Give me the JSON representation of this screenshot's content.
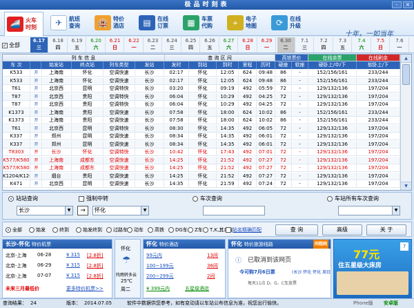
{
  "window": {
    "title": "极品时刻表",
    "minimize": "-",
    "close": "×"
  },
  "toolbar": {
    "items": [
      {
        "label": "火车时刻",
        "icon": "train-icon"
      },
      {
        "label": "航班查询",
        "icon": "plane-icon"
      },
      {
        "label": "特价酒店",
        "icon": "hotel-icon"
      },
      {
        "label": "在线订票",
        "icon": "ticket-icon"
      },
      {
        "label": "车票代购",
        "icon": "cart-icon"
      },
      {
        "label": "电子地图",
        "icon": "map-icon"
      },
      {
        "label": "在线升级",
        "icon": "upgrade-icon"
      }
    ],
    "slogan": "十年，一如当年"
  },
  "datebar": {
    "all_label": "全部",
    "dates": [
      {
        "date": "6.17",
        "week": "三"
      },
      {
        "date": "6.18",
        "week": "四"
      },
      {
        "date": "6.19",
        "week": "五"
      },
      {
        "date": "6.20",
        "week": "六"
      },
      {
        "date": "6.21",
        "week": "日"
      },
      {
        "date": "6.22",
        "week": "一"
      },
      {
        "date": "6.23",
        "week": "二"
      },
      {
        "date": "6.24",
        "week": "三"
      },
      {
        "date": "6.25",
        "week": "四"
      },
      {
        "date": "6.26",
        "week": "五"
      },
      {
        "date": "6.27",
        "week": "六"
      },
      {
        "date": "6.28",
        "week": "日"
      },
      {
        "date": "6.29",
        "week": "一"
      },
      {
        "date": "6.30",
        "week": "二"
      },
      {
        "date": "7.1",
        "week": "三"
      },
      {
        "date": "7.2",
        "week": "四"
      },
      {
        "date": "7.3",
        "week": "五"
      },
      {
        "date": "7.4",
        "week": "六"
      },
      {
        "date": "7.5",
        "week": "日"
      },
      {
        "date": "7.6",
        "week": "一"
      }
    ]
  },
  "grid": {
    "group_headers": [
      "列 车 信 息",
      "查 询 区 间",
      "高铁票价",
      "在线余票",
      "在线刷余"
    ],
    "columns": [
      "车 次",
      "",
      "始发站",
      "终点站",
      "列车类型",
      "发站",
      "发时",
      "到站",
      "到时",
      "里程",
      "历时",
      "硬座",
      "软座",
      "硬卧上/中/下",
      "软卧上/下"
    ],
    "rows": [
      [
        "K533",
        "开",
        "上海南",
        "怀化",
        "空调快速",
        "长沙",
        "02:17",
        "怀化",
        "12:05",
        "624",
        "09:48",
        "86",
        "-",
        "152/156/161",
        "233/244"
      ],
      [
        "K533",
        "开",
        "上海南",
        "怀化",
        "空调快速",
        "长沙",
        "02:17",
        "怀化",
        "12:05",
        "624",
        "09:48",
        "86",
        "-",
        "152/156/161",
        "233/244"
      ],
      [
        "T61",
        "开",
        "北京西",
        "昆明",
        "空调特快",
        "长沙",
        "03:20",
        "怀化",
        "09:19",
        "492",
        "05:59",
        "72",
        "-",
        "129/132/136",
        "197/204"
      ],
      [
        "T87",
        "开",
        "北京西",
        "贵阳",
        "空调特快",
        "长沙",
        "06:04",
        "怀化",
        "10:29",
        "492",
        "04:25",
        "72",
        "-",
        "129/132/136",
        "197/204"
      ],
      [
        "T87",
        "开",
        "北京西",
        "贵阳",
        "空调特快",
        "长沙",
        "06:04",
        "怀化",
        "10:29",
        "492",
        "04:25",
        "72",
        "-",
        "129/132/136",
        "197/204"
      ],
      [
        "K1373",
        "开",
        "上海南",
        "贵阳",
        "空调快速",
        "长沙",
        "07:58",
        "怀化",
        "18:00",
        "624",
        "10:02",
        "86",
        "-",
        "152/156/161",
        "233/244"
      ],
      [
        "K1373",
        "开",
        "上海南",
        "贵阳",
        "空调快速",
        "长沙",
        "07:58",
        "怀化",
        "18:00",
        "624",
        "10:02",
        "86",
        "-",
        "152/156/161",
        "233/244"
      ],
      [
        "T61",
        "开",
        "北京西",
        "昆明",
        "空调特快",
        "长沙",
        "08:30",
        "怀化",
        "14:35",
        "492",
        "06:05",
        "72",
        "-",
        "129/132/136",
        "197/204"
      ],
      [
        "K337",
        "开",
        "郑州",
        "昆明",
        "空调快速",
        "长沙",
        "08:34",
        "怀化",
        "14:35",
        "492",
        "06:01",
        "72",
        "-",
        "129/132/136",
        "197/204"
      ],
      [
        "K337",
        "开",
        "郑州",
        "昆明",
        "空调快速",
        "长沙",
        "08:34",
        "怀化",
        "14:35",
        "492",
        "06:01",
        "72",
        "-",
        "129/132/136",
        "197/204"
      ],
      [
        "T8303",
        "开",
        "长沙",
        "怀化",
        "空调特快",
        "长沙",
        "10:42",
        "怀化",
        "17:43",
        "492",
        "07:01",
        "72",
        "-",
        "129/132/136",
        "197/204"
      ],
      [
        "K577/K580",
        "开",
        "上海南",
        "成都东",
        "空调快速",
        "长沙",
        "14:25",
        "怀化",
        "21:52",
        "492",
        "07:27",
        "72",
        "-",
        "129/132/136",
        "197/204"
      ],
      [
        "K577/K580",
        "开",
        "上海南",
        "成都东",
        "空调快速",
        "长沙",
        "14:25",
        "怀化",
        "21:52",
        "492",
        "07:27",
        "72",
        "-",
        "129/132/136",
        "197/204"
      ],
      [
        "K1204/K1205",
        "开",
        "烟台",
        "贵阳",
        "空调快速",
        "长沙",
        "14:25",
        "怀化",
        "21:52",
        "492",
        "07:27",
        "72",
        "-",
        "129/132/136",
        "197/204"
      ],
      [
        "K471",
        "开",
        "北京西",
        "昆明",
        "空调快速",
        "长沙",
        "14:35",
        "怀化",
        "21:59",
        "492",
        "07:24",
        "72",
        "-",
        "129/132/136",
        "197/204"
      ]
    ]
  },
  "query": {
    "station_label": "站站查询",
    "transfer_label": "强制中转",
    "train_label": "车次查询",
    "station_all_label": "车站所有车次查询",
    "from": "长沙",
    "to": "怀化",
    "arrow": "→"
  },
  "filters": {
    "options": [
      "全部",
      "始发",
      "终到",
      "始发终到",
      "过路车",
      "动车",
      "高铁",
      "DG车",
      "Z车",
      "T,K,其余车"
    ],
    "exact_label": "站名精确匹配",
    "query_btn": "查 询",
    "advanced_btn": "高级",
    "about_btn": "关 于"
  },
  "promo_flight": {
    "title": "长沙-怀化",
    "subtitle": "特价机票",
    "items": [
      {
        "route": "北京-上海",
        "date": "06-28",
        "price": "¥ 315",
        "discount": "[2.8折]"
      },
      {
        "route": "北京-上海",
        "date": "06-29",
        "price": "¥ 315",
        "discount": "[2.8折]"
      },
      {
        "route": "北京-上海",
        "date": "07-07",
        "price": "¥ 315",
        "discount": "[2.8折]"
      }
    ],
    "footer_left": "未来三月最低价",
    "footer_right": "更多特价机票>>"
  },
  "weather": {
    "city": "怀化",
    "desc": "阵雨转多云",
    "temp": "25℃",
    "day": "周二"
  },
  "promo_hotel": {
    "title": "怀化",
    "subtitle": "特价酒店",
    "items": [
      {
        "price": "99元内",
        "count": "13间"
      },
      {
        "price": "100~199元",
        "count": "36间"
      },
      {
        "price": "200~299元",
        "count": "2间"
      }
    ],
    "footer_left": "¥ 399元内",
    "footer_right": "五星级酒店"
  },
  "promo_tour": {
    "title": "怀化",
    "subtitle": "特价旅游线路",
    "partner": "同程网",
    "notice": "已取消到该网页",
    "offer": "今可购7月6日票",
    "sub_offer": "(长沙 怀化 怀化 周日)",
    "hours": "每天11点 D、G、C车放票"
  },
  "ad": {
    "price": "77元",
    "text": "住五星级大床房"
  },
  "status": {
    "result_label": "查询结果：",
    "result_count": "24",
    "version_label": "版本：",
    "version": "2014.07.05",
    "disclaimer": "软件中数据供您参考，如有变动请以车站公布信息为准，祝您出行愉快。",
    "phone": "Phone版",
    "brand": "安卓版"
  }
}
